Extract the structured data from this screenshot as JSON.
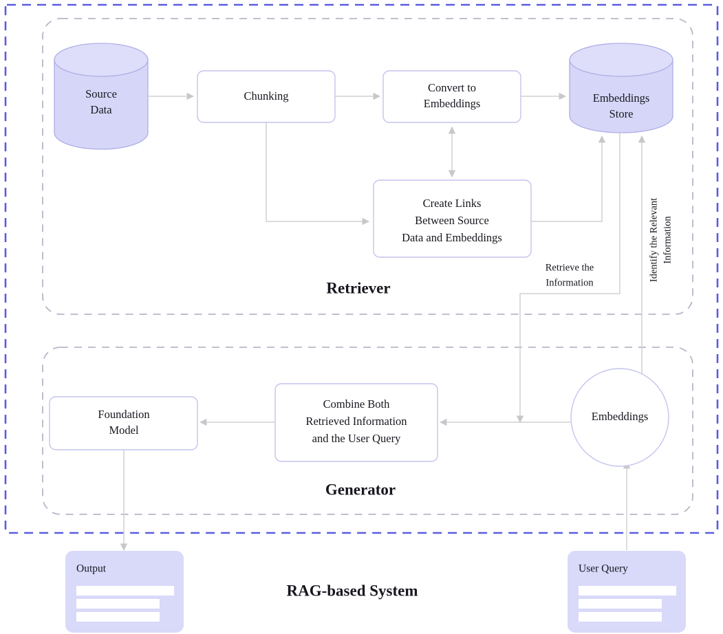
{
  "title": "RAG-based System",
  "colors": {
    "outer_frame": "#5b5be0",
    "group_frame": "#b6b6c8",
    "box_border": "#c3c3ee",
    "store_fill": "#d6d6f8",
    "card_fill": "#d9d9fa",
    "connector": "#d0d0d0",
    "text": "#17171f"
  },
  "sections": [
    {
      "id": "retriever",
      "label": "Retriever"
    },
    {
      "id": "generator",
      "label": "Generator"
    }
  ],
  "retriever": {
    "nodes": [
      {
        "id": "source-data",
        "shape": "cylinder",
        "lines": [
          "Source",
          "Data"
        ]
      },
      {
        "id": "chunking",
        "shape": "box",
        "lines": [
          "Chunking"
        ]
      },
      {
        "id": "convert-to-embeddings",
        "shape": "box",
        "lines": [
          "Convert to",
          "Embeddings"
        ]
      },
      {
        "id": "embeddings-store",
        "shape": "cylinder",
        "lines": [
          "Embeddings",
          "Store"
        ]
      },
      {
        "id": "create-links",
        "shape": "box",
        "lines": [
          "Create Links",
          "Between Source",
          "Data and Embeddings"
        ]
      }
    ]
  },
  "generator": {
    "nodes": [
      {
        "id": "foundation-model",
        "shape": "box",
        "lines": [
          "Foundation",
          "Model"
        ]
      },
      {
        "id": "combine-both",
        "shape": "box",
        "lines": [
          "Combine Both",
          "Retrieved Information",
          "and the User Query"
        ]
      },
      {
        "id": "embeddings",
        "shape": "circle",
        "lines": [
          "Embeddings"
        ]
      }
    ]
  },
  "edge_labels": [
    {
      "id": "retrieve-the-information",
      "lines": [
        "Retrieve the",
        "Information"
      ],
      "orientation": "horizontal"
    },
    {
      "id": "identify-the-relevant-information",
      "lines": [
        "Identify the Relevant",
        "Information"
      ],
      "orientation": "vertical"
    }
  ],
  "cards": [
    {
      "id": "output-card",
      "label": "Output",
      "bars": 3
    },
    {
      "id": "user-query-card",
      "label": "User Query",
      "bars": 3
    }
  ]
}
